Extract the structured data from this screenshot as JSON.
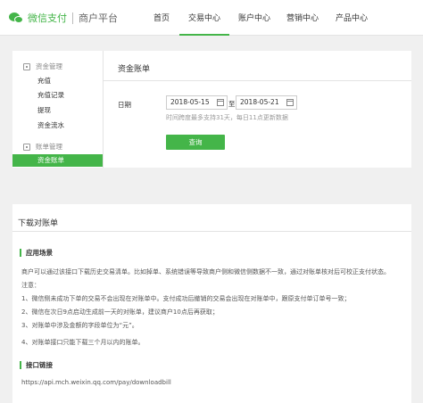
{
  "header": {
    "brand": "微信支付",
    "sub": "商户平台",
    "nav": [
      {
        "label": "首页"
      },
      {
        "label": "交易中心"
      },
      {
        "label": "账户中心"
      },
      {
        "label": "营销中心"
      },
      {
        "label": "产品中心"
      }
    ],
    "active_nav": "交易中心"
  },
  "sidebar": {
    "groups": [
      {
        "title": "资金管理",
        "icon": "wallet-icon",
        "items": [
          "充值",
          "充值记录",
          "提现",
          "资金流水"
        ]
      },
      {
        "title": "账单管理",
        "icon": "bill-icon",
        "items": [
          "资金账单"
        ]
      }
    ],
    "active_item": "资金账单"
  },
  "content": {
    "title": "资金账单",
    "date_label": "日期",
    "start_date": "2018-05-15",
    "to_label": "至",
    "end_date": "2018-05-21",
    "hint": "时间跨度最多支持31天，每日11点更新数据",
    "query_button": "查询"
  },
  "doc": {
    "title": "下载对账单",
    "section1_title": "应用场景",
    "intro": "商户可以通过该接口下载历史交易清单。比如掉单、系统错误等导致商户侧和微信侧数据不一致，通过对账单核对后可校正支付状态。",
    "note_label": "注意：",
    "notes": [
      "1、微信侧未成功下单的交易不会出现在对账单中。支付成功后撤销的交易会出现在对账单中，跟原支付单订单号一致；",
      "2、微信在次日9点启动生成前一天的对账单，建议商户10点后再获取；",
      "3、对账单中涉及金额的字段单位为“元”。",
      "4、对账单接口只能下载三个月以内的账单。"
    ],
    "section2_title": "接口链接",
    "link": "https://api.mch.weixin.qq.com/pay/downloadbill"
  },
  "colors": {
    "accent": "#44b549",
    "background": "#f0f0f0"
  }
}
